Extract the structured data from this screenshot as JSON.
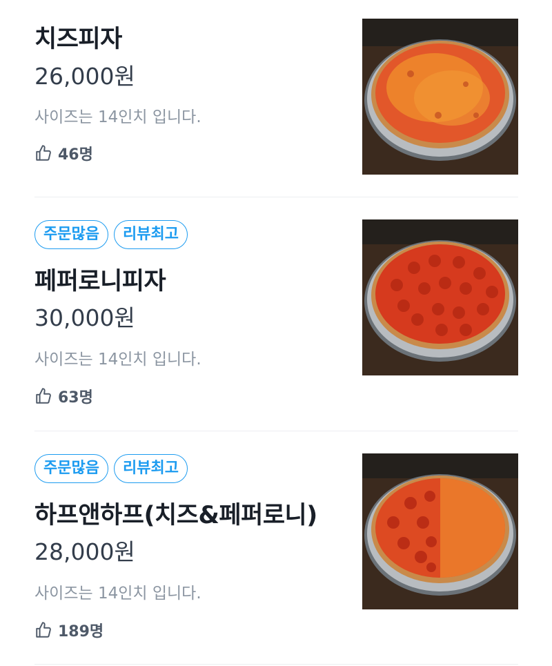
{
  "menu": {
    "items": [
      {
        "name": "치즈피자",
        "price": "26,000원",
        "description": "사이즈는 14인치 입니다.",
        "likes": "46명",
        "tags": [],
        "image": "cheese-pizza"
      },
      {
        "name": "페퍼로니피자",
        "price": "30,000원",
        "description": "사이즈는 14인치 입니다.",
        "likes": "63명",
        "tags": [
          "주문많음",
          "리뷰최고"
        ],
        "image": "pepperoni-pizza"
      },
      {
        "name": "하프앤하프(치즈&페퍼로니)",
        "price": "28,000원",
        "description": "사이즈는 14인치 입니다.",
        "likes": "189명",
        "tags": [
          "주문많음",
          "리뷰최고"
        ],
        "image": "half-and-half-pizza"
      }
    ]
  },
  "icons": {
    "like": "thumbs-up-icon"
  },
  "colors": {
    "tag_accent": "#1b9bf0",
    "title": "#191f28",
    "price": "#333d4b",
    "description": "#8b95a1",
    "likes": "#4e5968",
    "divider": "#eceef1"
  }
}
